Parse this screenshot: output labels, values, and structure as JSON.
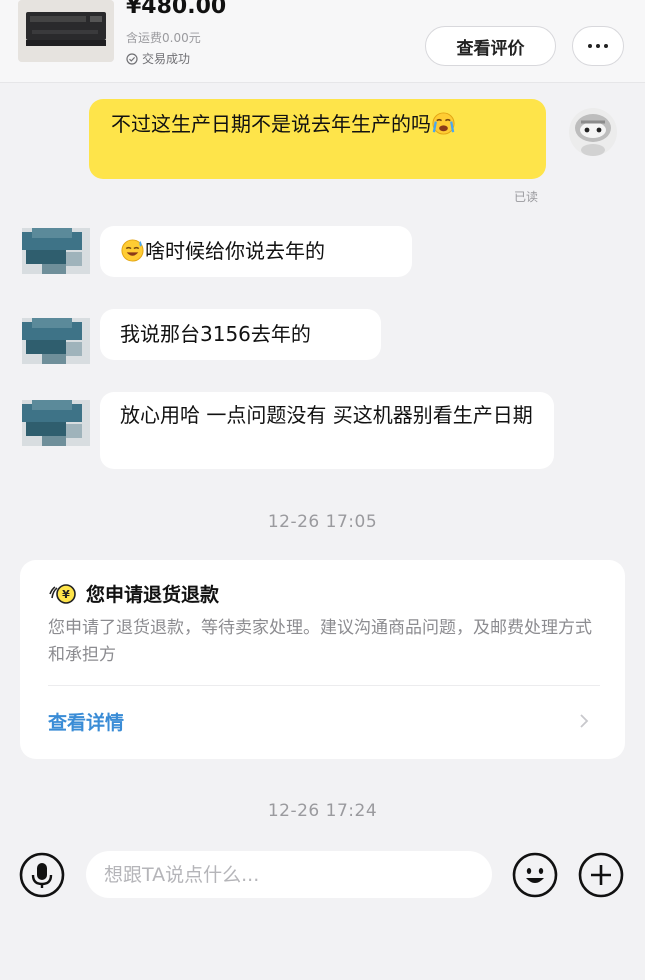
{
  "product": {
    "price": "¥480.00",
    "shipping": "含运费0.00元",
    "status": "交易成功",
    "view_review_label": "查看评价",
    "more_icon": "more-horizontal-icon"
  },
  "messages": [
    {
      "side": "mine",
      "text": "不过这生产日期不是说去年生产的吗",
      "trailing_emoji": "crying-emoji",
      "read_status": "已读"
    },
    {
      "side": "other",
      "leading_emoji": "sweat-smile-emoji",
      "text": "啥时候给你说去年的"
    },
    {
      "side": "other",
      "text": "我说那台3156去年的"
    },
    {
      "side": "other",
      "text": "放心用哈 一点问题没有 买这机器别看生产日期"
    }
  ],
  "timestamps": [
    "12-26 17:05",
    "12-26 17:24"
  ],
  "refund_card": {
    "icon": "refund-coin-icon",
    "title": "您申请退货退款",
    "description": "您申请了退货退款，等待卖家处理。建议沟通商品问题，及邮费处理方式和承担方",
    "link_label": "查看详情"
  },
  "input_bar": {
    "placeholder": "想跟TA说点什么...",
    "value": "",
    "icons": [
      "microphone-icon",
      "emoji-icon",
      "plus-icon"
    ]
  },
  "colors": {
    "mine_bubble": "#fee44a",
    "link_blue": "#3a8cd6",
    "background": "#f2f2f4"
  }
}
